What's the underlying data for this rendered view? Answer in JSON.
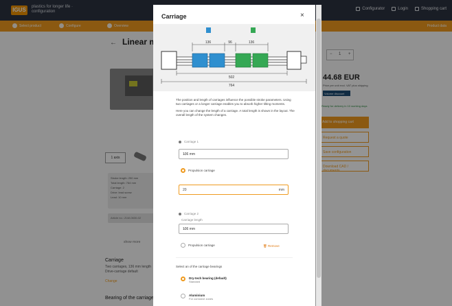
{
  "header": {
    "logo_text": "IGUS",
    "tagline": "plastics for longer life · configuration",
    "links": [
      {
        "label": "Configurator",
        "icon": "wrench-icon"
      },
      {
        "label": "Login",
        "icon": "user-icon"
      },
      {
        "label": "Shopping cart",
        "icon": "cart-icon"
      }
    ]
  },
  "steps": {
    "items": [
      "Select product",
      "Configure",
      "Overview"
    ],
    "right_text": "Product data"
  },
  "product": {
    "back_arrow": "←",
    "title": "Linear module",
    "thumb_label": "1 axis",
    "specs": [
      "Stroke length: 250 mm",
      "Total length: 764 mm",
      "Carriage: 2",
      "Drive: lead screw",
      "Lead: 10 mm"
    ],
    "spec_footer": "Article no.: ZLW-0630-02",
    "small_note": "show more",
    "carriage_heading": "Carriage",
    "carriage_lines": [
      "Two carriages, 136 mm length",
      "Drive-carriage default"
    ],
    "link": "Change",
    "bearing_heading": "Bearing of the carriage"
  },
  "buy": {
    "qty_minus": "−",
    "qty_value": "1",
    "qty_plus": "+",
    "price": "44.68 EUR",
    "price_note": "Price per unit excl. VAT plus shipping",
    "price_badge": "Volume discount",
    "availability": "Ready for delivery in 10 working days",
    "primary_button": "Add to shopping cart",
    "outline_buttons": [
      "Request a quote",
      "Save configuration",
      "Download CAD / documents"
    ]
  },
  "modal": {
    "title": "Carriage",
    "close": "×",
    "diagram": {
      "dim_labels": [
        "136",
        "96",
        "136"
      ],
      "length_inner": "502",
      "length_total": "764",
      "carriage_colors": [
        "#2f8fcf",
        "#35a854"
      ]
    },
    "description": [
      "The position and length of carriages influence the possible stroke parameters. Using two carriages or a longer carriage enables you to absorb higher tilting moments.",
      "Here you can change the length of a carriage. A total length is shown in the layout. The overall length of the system changes."
    ],
    "carriage1": {
      "label": "Carriage 1",
      "select_value": "136 mm",
      "chevron": "⌄",
      "radio_label": "Propulsion carriage"
    },
    "input": {
      "value": "20",
      "unit": "mm"
    },
    "carriage2": {
      "label": "Carriage 2",
      "sublabel": "Carriage length",
      "select_value": "136 mm",
      "chevron": "⌄",
      "radio_label": "Propulsion carriage",
      "remove_label": "Remove"
    },
    "option_title": "Select an of the carriage bearings",
    "options": [
      {
        "title": "Dry-tech bearing (default)",
        "subtitle": "Standard",
        "selected": true
      },
      {
        "title": "Aluminium",
        "subtitle": "For corrosive zones",
        "selected": false
      }
    ]
  }
}
